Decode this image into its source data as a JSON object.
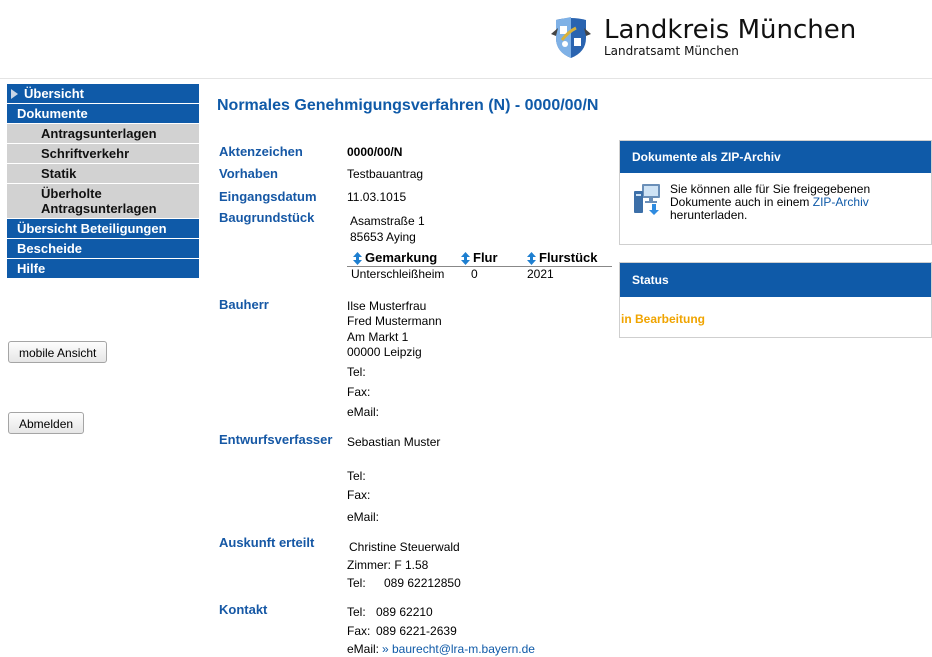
{
  "header": {
    "logo_title": "Landkreis München",
    "logo_subtitle": "Landratsamt München"
  },
  "sidebar": {
    "items": [
      {
        "label": "Übersicht"
      },
      {
        "label": "Dokumente"
      },
      {
        "label": "Antragsunterlagen"
      },
      {
        "label": "Schriftverkehr"
      },
      {
        "label": "Statik"
      },
      {
        "label": "Überholte Antragsunterlagen"
      },
      {
        "label": "Übersicht Beteiligungen"
      },
      {
        "label": "Bescheide"
      },
      {
        "label": "Hilfe"
      }
    ],
    "mobile_button": "mobile Ansicht",
    "logout_button": "Abmelden"
  },
  "main": {
    "title": "Normales Genehmigungsverfahren (N) - 0000/00/N",
    "labels": {
      "aktenzeichen": "Aktenzeichen",
      "vorhaben": "Vorhaben",
      "eingangsdatum": "Eingangsdatum",
      "baugrundstueck": "Baugrundstück",
      "bauherr": "Bauherr",
      "entwurfsverfasser": "Entwurfsverfasser",
      "auskunft": "Auskunft erteilt",
      "kontakt": "Kontakt"
    },
    "aktenzeichen": "0000/00/N",
    "vorhaben": "Testbauantrag",
    "eingangsdatum": "11.03.1015",
    "baugrundstueck": {
      "street": "Asamstraße 1",
      "city": "85653 Aying",
      "table_headers": [
        "Gemarkung",
        "Flur",
        "Flurstück"
      ],
      "row": [
        "Unterschleißheim",
        "0",
        "2021"
      ]
    },
    "bauherr": {
      "name1": "Ilse Musterfrau",
      "name2": "Fred Mustermann",
      "street": "Am Markt 1",
      "city": "00000 Leipzig",
      "tel": "Tel:",
      "fax": "Fax:",
      "email": "eMail:"
    },
    "entwurfsverfasser": {
      "name": "Sebastian Muster",
      "tel": "Tel:",
      "fax": "Fax:",
      "email": "eMail:"
    },
    "auskunft": {
      "name": "Christine Steuerwald",
      "zimmer": "Zimmer: F 1.58",
      "tel_label": "Tel:",
      "tel": "089 62212850"
    },
    "kontakt": {
      "tel_label": "Tel:",
      "tel": "089 62210",
      "fax_label": "Fax:",
      "fax": "089 6221-2639",
      "email_label": "eMail:",
      "email": "» baurecht@lra-m.bayern.de"
    }
  },
  "zip_panel": {
    "title": "Dokumente als ZIP-Archiv",
    "text_before": "Sie können alle für Sie freigegebenen Dokumente auch in einem",
    "link": "ZIP-Archiv",
    "text_after": "herunterladen."
  },
  "status_panel": {
    "title": "Status",
    "value": "in Bearbeitung"
  },
  "colors": {
    "brand_blue": "#0f5aa8",
    "status_orange": "#f0a400"
  }
}
